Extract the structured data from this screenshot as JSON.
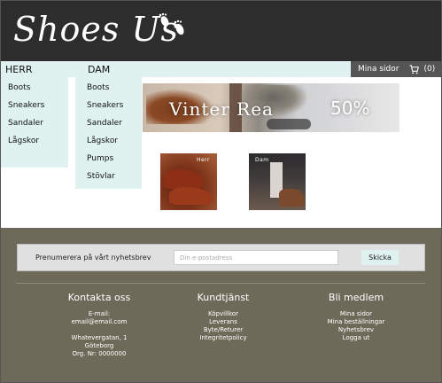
{
  "header": {
    "logo_text": "Shoes Us",
    "logo_icon": "footprints-icon"
  },
  "nav": {
    "herr_label": "HERR",
    "dam_label": "DAM",
    "my_pages": "Mina sidor",
    "cart_count": "(0)",
    "cart_icon": "cart-icon"
  },
  "herr_menu": [
    "Boots",
    "Sneakers",
    "Sandaler",
    "Lågskor"
  ],
  "dam_menu": [
    "Boots",
    "Sneakers",
    "Sandaler",
    "Lågskor",
    "Pumps",
    "Stövlar"
  ],
  "banner": {
    "title": "Vinter Rea",
    "sale": "50%"
  },
  "tiles": {
    "herr": "Herr",
    "dam": "Dam"
  },
  "newsletter": {
    "label": "Prenumerera på vårt nyhetsbrev",
    "placeholder": "Din e-postadress",
    "button": "Skicka"
  },
  "footer": {
    "contact": {
      "title": "Kontakta oss",
      "email_label": "E-mail:",
      "email": "email@email.com",
      "street": "Whatevergatan, 1",
      "city": "Göteborg",
      "org": "Org. Nr: 0000000"
    },
    "service": {
      "title": "Kundtjänst",
      "links": [
        "Köpvillkor",
        "Leverans",
        "Byte/Returer",
        "Integritetpolicy"
      ]
    },
    "member": {
      "title": "Bli medlem",
      "links": [
        "Mina sidor",
        "Mina beställningar",
        "Nyhetsbrev",
        "Logga ut"
      ]
    }
  },
  "colors": {
    "header_bg": "#2d2d2d",
    "nav_bg": "#dff2ef",
    "footer_bg": "#6e6a5a",
    "user_box_bg": "#555555"
  }
}
